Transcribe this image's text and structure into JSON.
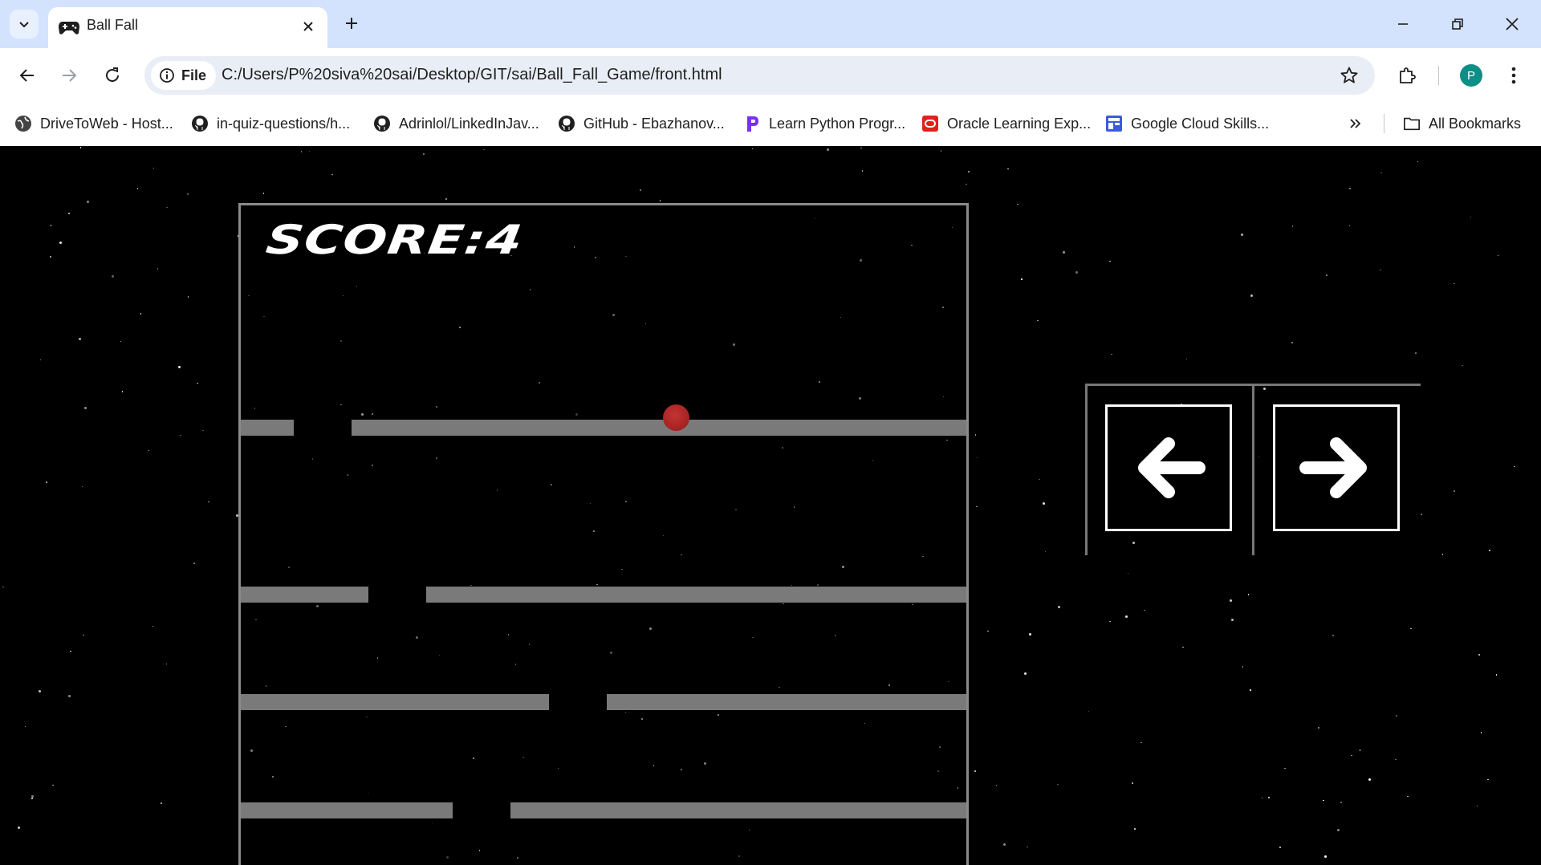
{
  "browser": {
    "tab": {
      "title": "Ball Fall",
      "icon": "gamepad-icon"
    },
    "window_controls": [
      "minimize-icon",
      "restore-icon",
      "close-icon"
    ],
    "address_bar": {
      "chip_label": "File",
      "url": "C:/Users/P%20siva%20sai/Desktop/GIT/sai/Ball_Fall_Game/front.html"
    },
    "profile_initial": "P",
    "bookmarks": [
      {
        "label": "DriveToWeb - Host...",
        "icon": "globe-icon"
      },
      {
        "label": "in-quiz-questions/h...",
        "icon": "github-icon"
      },
      {
        "label": "Adrinlol/LinkedInJav...",
        "icon": "github-icon"
      },
      {
        "label": "GitHub - Ebazhanov...",
        "icon": "github-icon"
      },
      {
        "label": "Learn Python Progr...",
        "icon": "p-logo-icon"
      },
      {
        "label": "Oracle Learning Exp...",
        "icon": "oracle-icon"
      },
      {
        "label": "Google Cloud Skills...",
        "icon": "cloud-skills-icon"
      }
    ],
    "all_bookmarks_label": "All Bookmarks"
  },
  "game": {
    "score_text": "SCORE:4",
    "ball_color": "#a32222",
    "platform_color": "#7a7a7a",
    "controls": {
      "left": "left-arrow-icon",
      "right": "right-arrow-icon"
    }
  },
  "colors": {
    "tabstrip": "#d3e3fd",
    "omnibox": "#e9eef6",
    "avatar": "#0b8f87"
  }
}
